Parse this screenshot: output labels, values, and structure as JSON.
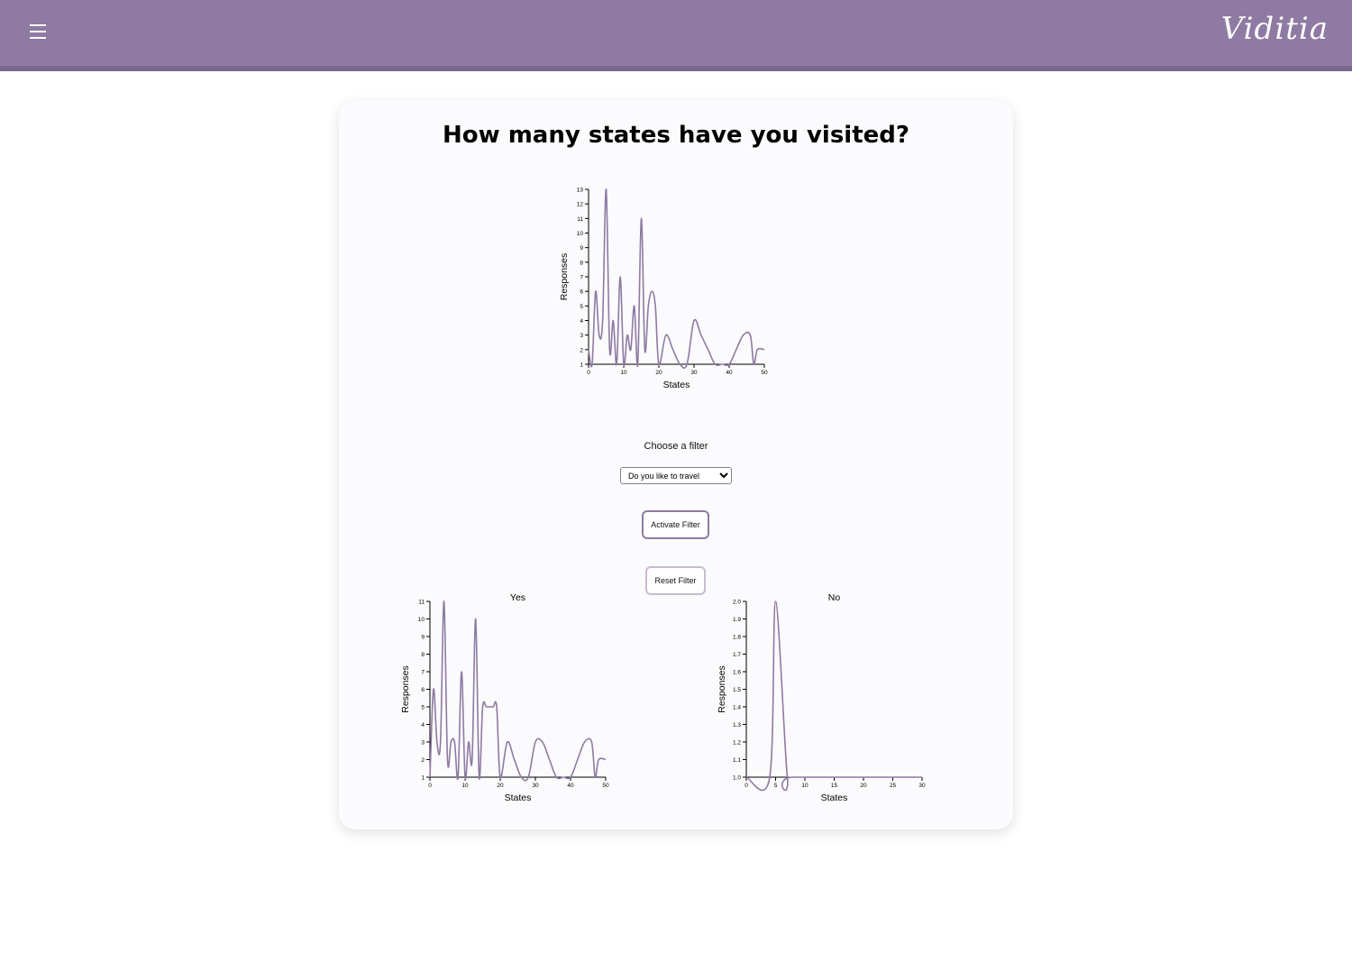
{
  "header": {
    "menu_icon": "hamburger-menu-icon",
    "logo_text": "Viditia",
    "background_color": "#8f7aa3"
  },
  "page": {
    "title": "How many states have you visited?"
  },
  "filter": {
    "label": "Choose a filter",
    "selected_option": "Do you like to travel",
    "activate_label": "Activate Filter",
    "reset_label": "Reset Filter"
  },
  "colors": {
    "line": "#8f7aa3",
    "accent": "#8f7aa3"
  },
  "chart_data": [
    {
      "type": "line",
      "title": "",
      "xlabel": "States",
      "ylabel": "Responses",
      "xlim": [
        0,
        50
      ],
      "ylim": [
        1,
        13
      ],
      "xticks": [
        0,
        10,
        20,
        30,
        40,
        50
      ],
      "yticks": [
        1,
        2,
        3,
        4,
        5,
        6,
        7,
        8,
        9,
        10,
        11,
        12,
        13
      ],
      "x": [
        0,
        1,
        2,
        3,
        4,
        5,
        6,
        7,
        8,
        9,
        10,
        11,
        12,
        13,
        14,
        15,
        16,
        17,
        18,
        19,
        20,
        22,
        24,
        26,
        28,
        30,
        32,
        34,
        36,
        38,
        40,
        42,
        44,
        46,
        47,
        48,
        50
      ],
      "y": [
        2,
        1,
        6,
        3,
        4,
        13,
        2,
        4,
        1,
        7,
        1,
        3,
        2,
        5,
        1,
        11,
        2,
        5,
        6,
        5,
        1,
        3,
        2,
        1,
        1,
        4,
        3,
        2,
        1,
        1,
        1,
        2,
        3,
        3,
        1,
        2,
        2
      ]
    },
    {
      "type": "line",
      "title": "Yes",
      "xlabel": "States",
      "ylabel": "Responses",
      "xlim": [
        0,
        50
      ],
      "ylim": [
        1,
        11
      ],
      "xticks": [
        0,
        10,
        20,
        30,
        40,
        50
      ],
      "yticks": [
        1,
        2,
        3,
        4,
        5,
        6,
        7,
        8,
        9,
        10,
        11
      ],
      "x": [
        0,
        1,
        2,
        3,
        4,
        5,
        6,
        7,
        8,
        9,
        10,
        11,
        12,
        13,
        14,
        15,
        16,
        17,
        18,
        19,
        20,
        22,
        24,
        26,
        28,
        30,
        32,
        34,
        36,
        38,
        40,
        42,
        44,
        46,
        47,
        48,
        50
      ],
      "y": [
        1,
        6,
        3,
        3,
        11,
        2,
        3,
        3,
        1,
        7,
        1,
        3,
        2,
        10,
        1,
        5,
        5,
        5,
        5,
        5,
        1,
        3,
        2,
        1,
        1,
        3,
        3,
        2,
        1,
        1,
        1,
        2,
        3,
        3,
        1,
        2,
        2
      ]
    },
    {
      "type": "line",
      "title": "No",
      "xlabel": "States",
      "ylabel": "Responses",
      "xlim": [
        0,
        30
      ],
      "ylim": [
        1.0,
        2.0
      ],
      "xticks": [
        0,
        5,
        10,
        15,
        20,
        25,
        30
      ],
      "yticks": [
        "1.0",
        "1.1",
        "1.2",
        "1.3",
        "1.4",
        "1.5",
        "1.6",
        "1.7",
        "1.8",
        "1.9",
        "2.0"
      ],
      "x": [
        0,
        4,
        5,
        7,
        8,
        30
      ],
      "y": [
        1,
        1,
        2,
        1,
        1,
        1
      ]
    }
  ]
}
